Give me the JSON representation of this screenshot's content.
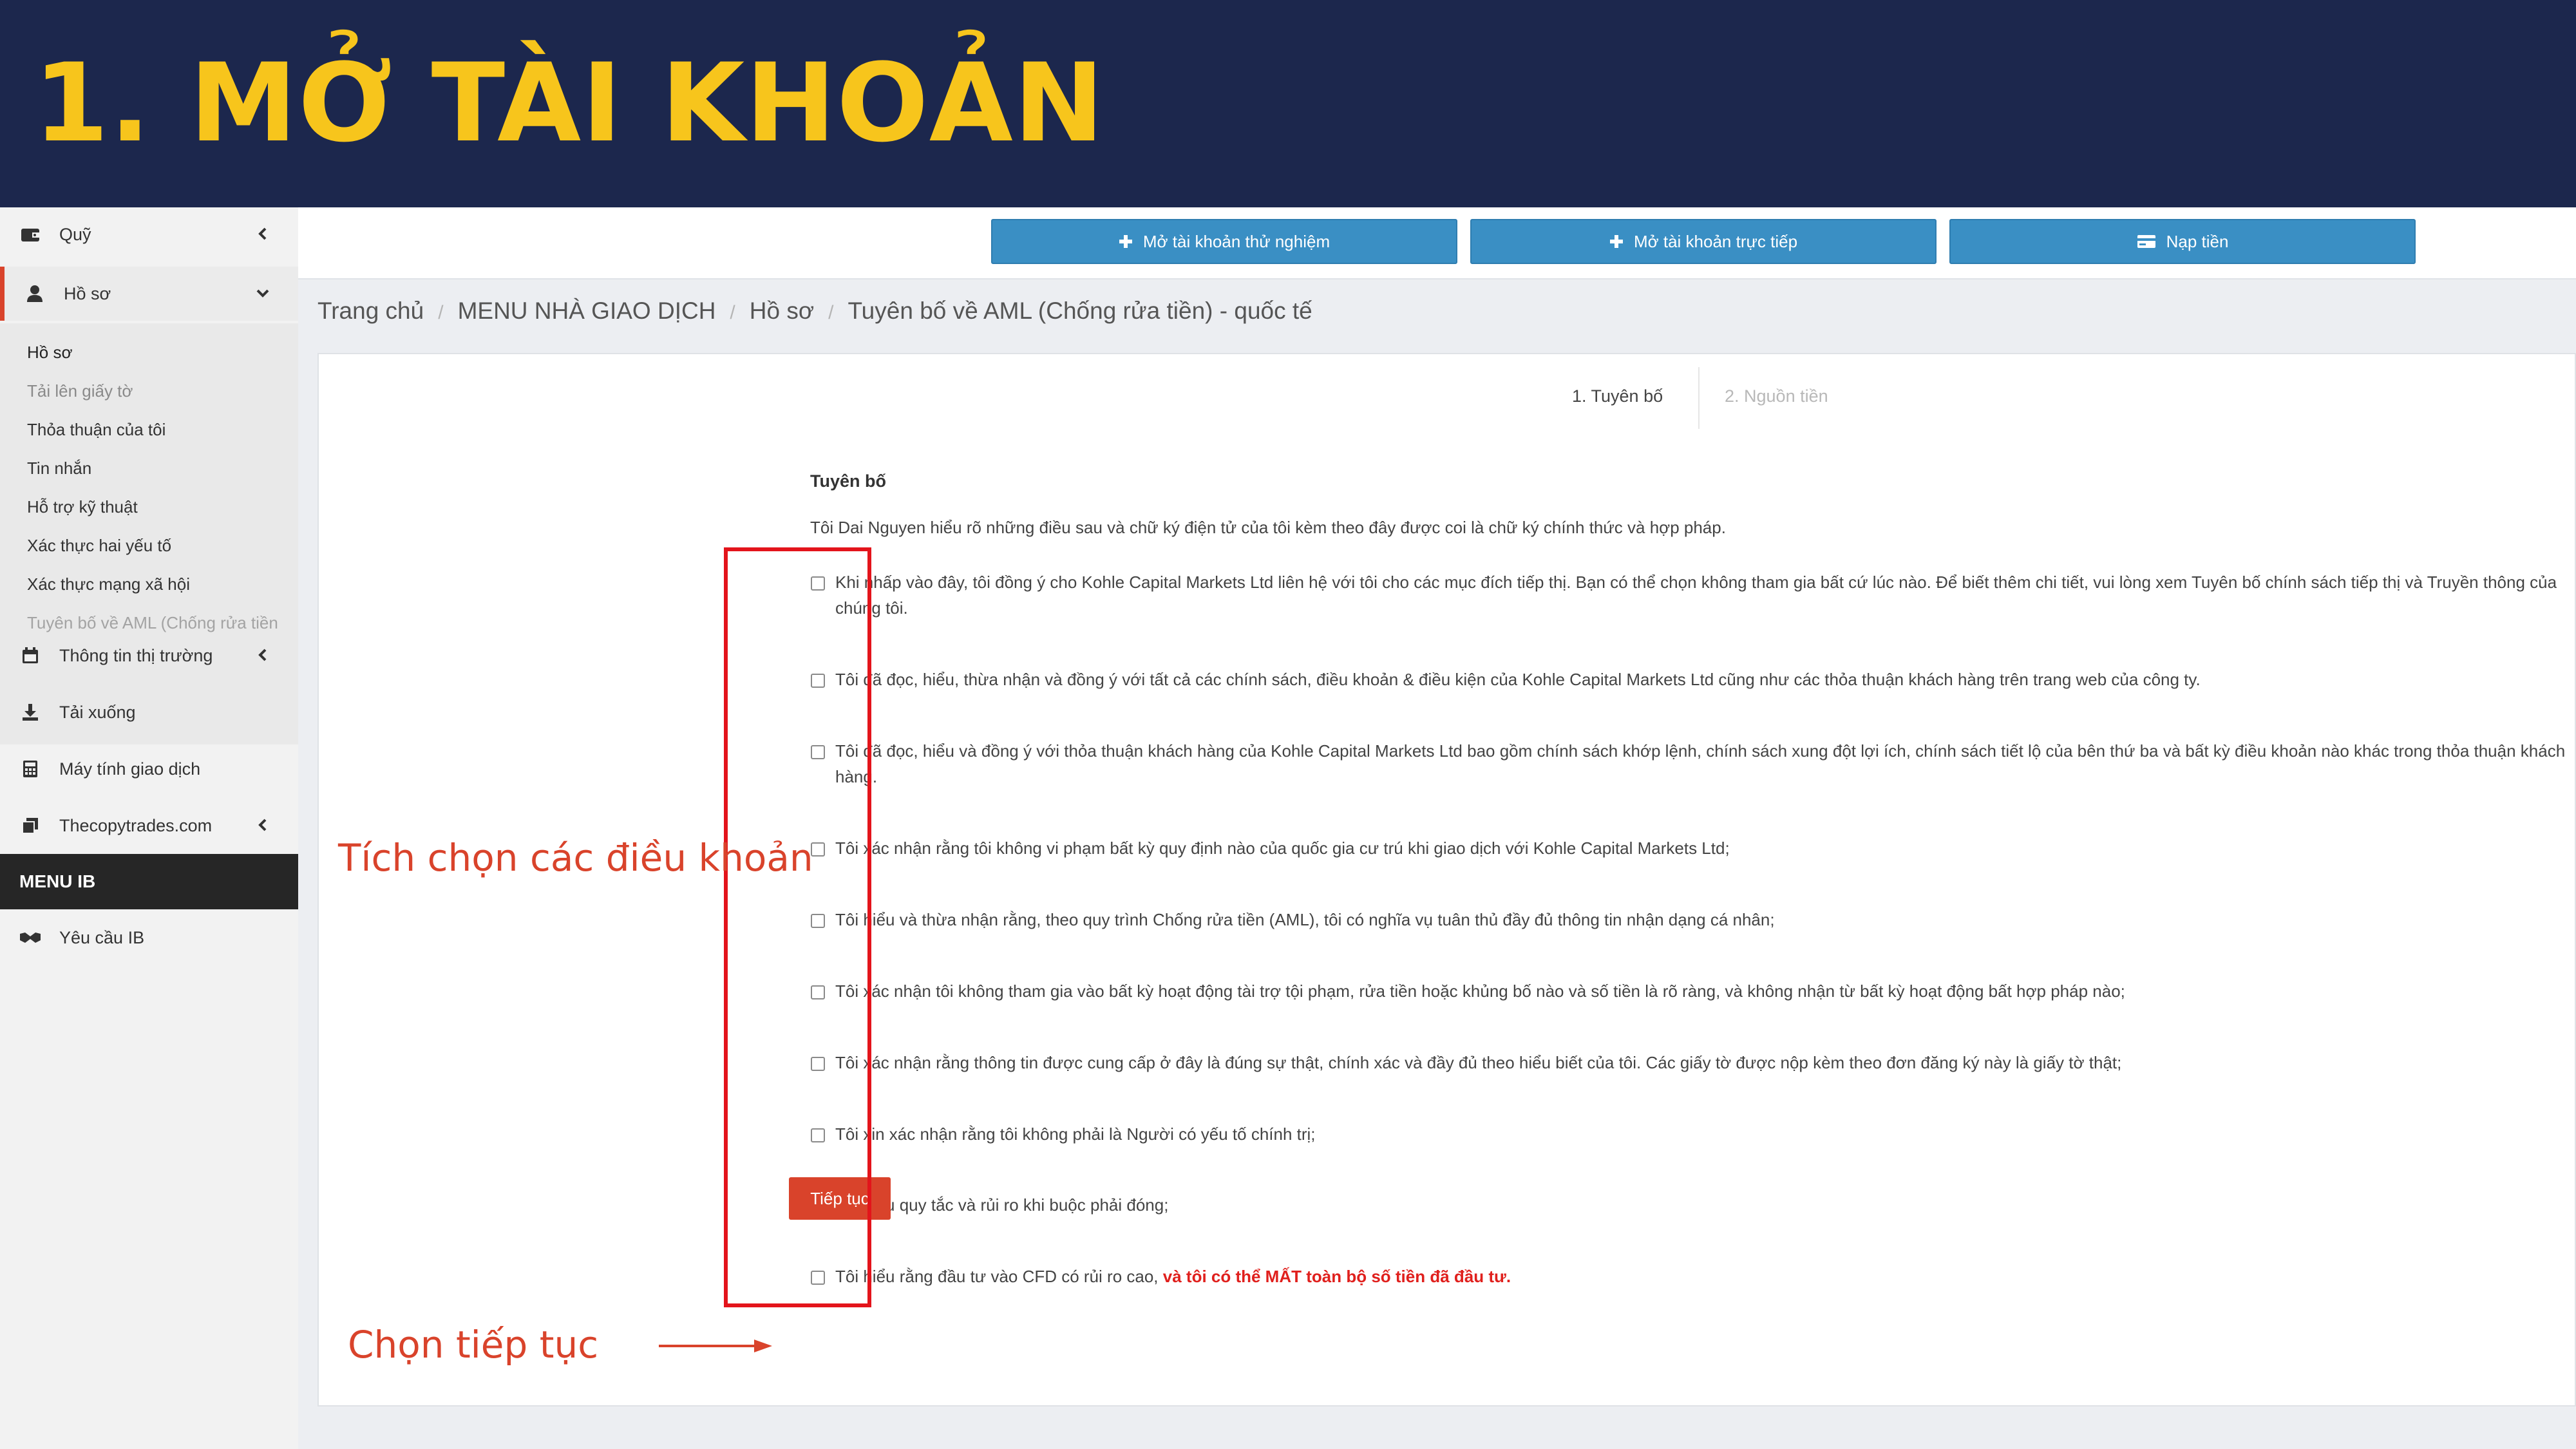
{
  "banner": {
    "title": "1. MỞ TÀI KHOẢN"
  },
  "colors": {
    "banner_bg": "#1c274d",
    "banner_text": "#f7c51c",
    "accent": "#d9432b",
    "button_blue": "#3a8fc4",
    "warning_red": "#e0201d",
    "annotation_red": "#e3141b"
  },
  "sidebar": {
    "items": [
      {
        "label": "Quỹ",
        "icon": "wallet-icon"
      },
      {
        "label": "Hồ sơ",
        "icon": "user-icon"
      },
      {
        "label": "Thông tin thị trường",
        "icon": "calendar-icon"
      },
      {
        "label": "Tải xuống",
        "icon": "download-icon"
      },
      {
        "label": "Máy tính giao dịch",
        "icon": "calculator-icon"
      },
      {
        "label": "Thecopytrades.com",
        "icon": "copy-icon"
      }
    ],
    "submenu": [
      "Hồ sơ",
      "Tải lên giấy tờ",
      "Thỏa thuận của tôi",
      "Tin nhắn",
      "Hỗ trợ kỹ thuật",
      "Xác thực hai yếu tố",
      "Xác thực mạng xã hội",
      "Tuyên bố về AML (Chống rửa tiền"
    ],
    "menu_ib": "MENU IB",
    "ib_item": {
      "label": "Yêu cầu IB",
      "icon": "handshake-icon"
    }
  },
  "topbar": {
    "demo_button": "Mở tài khoản thử nghiệm",
    "live_button": "Mở tài khoản trực tiếp",
    "deposit_button": "Nạp tiền"
  },
  "breadcrumb": [
    "Trang chủ",
    "MENU NHÀ GIAO DỊCH",
    "Hồ sơ",
    "Tuyên bố về AML (Chống rửa tiền) - quốc tế"
  ],
  "steps": {
    "step1": "1. Tuyên bố",
    "step2": "2. Nguồn tiền"
  },
  "declaration": {
    "title": "Tuyên bố",
    "intro": "Tôi Dai Nguyen hiểu rõ những điều sau và chữ ký điện tử của tôi kèm theo đây được coi là chữ ký chính thức và hợp pháp.",
    "items": [
      "Khi nhấp vào đây, tôi đồng ý cho Kohle Capital Markets Ltd liên hệ với tôi cho các mục đích tiếp thị. Bạn có thể chọn không tham gia bất cứ lúc nào. Để biết thêm chi tiết, vui lòng xem Tuyên bố chính sách tiếp thị và Truyền thông của chúng tôi.",
      "Tôi đã đọc, hiểu, thừa nhận và đồng ý với tất cả các chính sách, điều khoản & điều kiện của Kohle Capital Markets Ltd cũng như các thỏa thuận khách hàng trên trang web của công ty.",
      "Tôi đã đọc, hiểu và đồng ý với thỏa thuận khách hàng của Kohle Capital Markets Ltd bao gồm chính sách khớp lệnh, chính sách xung đột lợi ích, chính sách tiết lộ của bên thứ ba và bất kỳ điều khoản nào khác trong thỏa thuận khách hàng.",
      "Tôi xác nhận rằng tôi không vi phạm bất kỳ quy định nào của quốc gia cư trú khi giao dịch với Kohle Capital Markets Ltd;",
      "Tôi hiểu và thừa nhận rằng, theo quy trình Chống rửa tiền (AML), tôi có nghĩa vụ tuân thủ đầy đủ thông tin nhận dạng cá nhân;",
      "Tôi xác nhận tôi không tham gia vào bất kỳ hoạt động tài trợ tội phạm, rửa tiền hoặc khủng bố nào và số tiền là rõ ràng, và không nhận từ bất kỳ hoạt động bất hợp pháp nào;",
      "Tôi xác nhận rằng thông tin được cung cấp ở đây là đúng sự thật, chính xác và đầy đủ theo hiểu biết của tôi. Các giấy tờ được nộp kèm theo đơn đăng ký này là giấy tờ thật;",
      "Tôi xin xác nhận rằng tôi không phải là Người có yếu tố chính trị;",
      "Tôi hiểu quy tắc và rủi ro khi buộc phải đóng;",
      "Tôi hiểu rằng đầu tư vào CFD có rủi ro cao,"
    ],
    "last_warning": "và tôi có thể MẤT toàn bộ số tiền đã đầu tư.",
    "continue_button": "Tiếp tục"
  },
  "annotations": {
    "tick_terms": "Tích chọn các điều khoản",
    "choose_continue": "Chọn tiếp tục"
  }
}
